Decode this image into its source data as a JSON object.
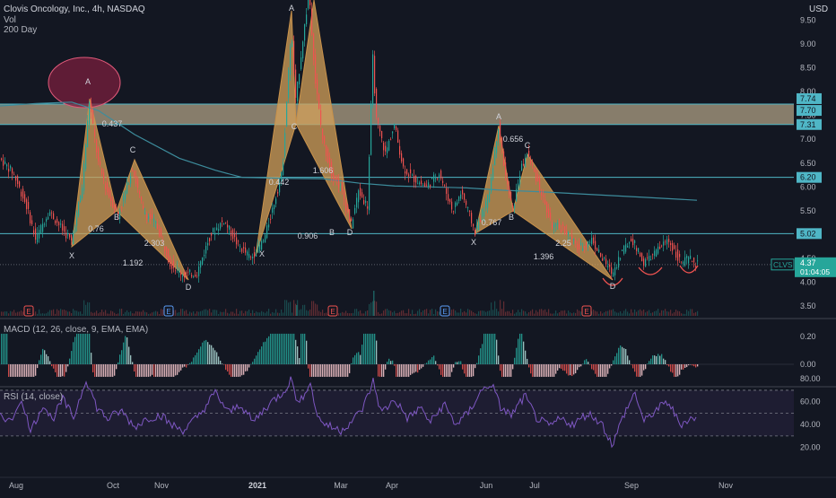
{
  "header": {
    "symbol_line": "Clovis Oncology, Inc., 4h, NASDAQ",
    "vol_label": "Vol",
    "ma_label": "200 Day",
    "currency": "USD"
  },
  "panes": {
    "macd_label": "MACD (12, 26, close, 9, EMA, EMA)",
    "rsi_label": "RSI (14, close)"
  },
  "colors": {
    "background": "#131722",
    "up_candle": "#26a69a",
    "down_candle": "#ef5350",
    "pattern_fill": "#d4a15a",
    "level_line": "#4fb6c6",
    "zone_fill": "#e8d2a8",
    "ma_line": "#3d8c9c",
    "rsi_line": "#7e57c2",
    "circle_fill": "#7a1f3d"
  },
  "chart_data": [
    {
      "type": "candlestick",
      "title": "Clovis Oncology, Inc., 4h, NASDAQ",
      "x_ticks": [
        "Aug",
        "Oct",
        "Nov",
        "2021",
        "Mar",
        "Apr",
        "Jun",
        "Jul",
        "Sep",
        "Nov"
      ],
      "y_ticks": [
        3.5,
        4.0,
        4.5,
        5.0,
        5.5,
        6.0,
        6.5,
        7.0,
        7.5,
        8.0,
        8.5,
        9.0,
        9.5
      ],
      "y_range": [
        3.3,
        10.0
      ],
      "last_price": 4.37,
      "countdown": "01:04:05",
      "ticker_tag": "CLVS",
      "price_labels": [
        7.74,
        7.7,
        7.31,
        6.2,
        5.02
      ],
      "horizontal_levels": [
        7.74,
        7.31,
        6.2,
        5.02
      ],
      "resistance_zone": [
        7.31,
        7.74
      ],
      "moving_average": {
        "name": "200 Day",
        "points": [
          [
            0,
            7.7
          ],
          [
            40,
            7.75
          ],
          [
            80,
            7.78
          ],
          [
            110,
            7.6
          ],
          [
            150,
            7.1
          ],
          [
            200,
            6.6
          ],
          [
            240,
            6.35
          ],
          [
            270,
            6.2
          ],
          [
            320,
            6.18
          ],
          [
            360,
            6.17
          ],
          [
            400,
            6.08
          ],
          [
            440,
            6.02
          ],
          [
            480,
            6.0
          ],
          [
            520,
            5.98
          ],
          [
            560,
            5.93
          ],
          [
            600,
            5.9
          ],
          [
            640,
            5.86
          ],
          [
            680,
            5.82
          ],
          [
            720,
            5.78
          ],
          [
            777,
            5.72
          ]
        ]
      },
      "price_path": [
        [
          0,
          6.6
        ],
        [
          15,
          6.3
        ],
        [
          30,
          5.6
        ],
        [
          40,
          4.9
        ],
        [
          55,
          5.5
        ],
        [
          70,
          5.1
        ],
        [
          80,
          4.85
        ],
        [
          92,
          6.0
        ],
        [
          100,
          7.8
        ],
        [
          110,
          6.5
        ],
        [
          120,
          5.9
        ],
        [
          132,
          5.4
        ],
        [
          140,
          5.9
        ],
        [
          148,
          6.4
        ],
        [
          160,
          5.5
        ],
        [
          175,
          5.2
        ],
        [
          190,
          4.4
        ],
        [
          205,
          4.15
        ],
        [
          220,
          4.2
        ],
        [
          235,
          5.0
        ],
        [
          250,
          5.3
        ],
        [
          265,
          4.8
        ],
        [
          280,
          4.5
        ],
        [
          295,
          4.9
        ],
        [
          305,
          5.6
        ],
        [
          315,
          6.3
        ],
        [
          325,
          9.3
        ],
        [
          330,
          7.8
        ],
        [
          338,
          9.1
        ],
        [
          345,
          10.1
        ],
        [
          352,
          8.2
        ],
        [
          360,
          7.0
        ],
        [
          370,
          6.3
        ],
        [
          380,
          6.0
        ],
        [
          392,
          5.2
        ],
        [
          400,
          5.9
        ],
        [
          410,
          5.6
        ],
        [
          416,
          8.7
        ],
        [
          420,
          7.4
        ],
        [
          430,
          6.7
        ],
        [
          440,
          7.3
        ],
        [
          450,
          6.4
        ],
        [
          460,
          6.2
        ],
        [
          475,
          6.0
        ],
        [
          490,
          6.3
        ],
        [
          505,
          5.5
        ],
        [
          515,
          5.9
        ],
        [
          530,
          5.05
        ],
        [
          545,
          5.8
        ],
        [
          556,
          7.3
        ],
        [
          565,
          6.1
        ],
        [
          572,
          5.5
        ],
        [
          580,
          6.3
        ],
        [
          588,
          6.7
        ],
        [
          600,
          6.1
        ],
        [
          615,
          5.2
        ],
        [
          630,
          5.1
        ],
        [
          645,
          4.7
        ],
        [
          660,
          4.9
        ],
        [
          670,
          4.55
        ],
        [
          683,
          4.18
        ],
        [
          695,
          4.7
        ],
        [
          705,
          4.9
        ],
        [
          718,
          4.4
        ],
        [
          730,
          4.6
        ],
        [
          745,
          4.9
        ],
        [
          760,
          4.4
        ],
        [
          768,
          4.5
        ],
        [
          777,
          4.37
        ]
      ],
      "patterns": [
        {
          "points": [
            "X",
            "A",
            "B",
            "C",
            "D"
          ],
          "ratios": [
            "0.437",
            "0.76",
            "2.303",
            "1.192"
          ]
        },
        {
          "points": [
            "X",
            "A",
            "B",
            "C",
            "D"
          ],
          "ratios": [
            "0.442",
            "1.606",
            "0.906"
          ]
        },
        {
          "points": [
            "X",
            "A",
            "B",
            "C",
            "D"
          ],
          "ratios": [
            "0.656",
            "0.767",
            "2.25",
            "1.396"
          ]
        }
      ],
      "earnings_markers": [
        "E",
        "E",
        "E",
        "E",
        "E"
      ]
    },
    {
      "type": "line",
      "title": "MACD (12, 26, close, 9, EMA, EMA)",
      "y_ticks": [
        0.2,
        0.0
      ],
      "y_range": [
        -0.1,
        0.3
      ]
    },
    {
      "type": "line",
      "title": "RSI (14, close)",
      "y_ticks": [
        80.0,
        60.0,
        40.0,
        20.0
      ],
      "y_range": [
        15,
        90
      ],
      "bands": [
        70,
        50,
        30
      ],
      "points": [
        [
          0,
          50
        ],
        [
          12,
          42
        ],
        [
          22,
          62
        ],
        [
          35,
          35
        ],
        [
          48,
          58
        ],
        [
          58,
          44
        ],
        [
          70,
          62
        ],
        [
          82,
          46
        ],
        [
          96,
          80
        ],
        [
          108,
          55
        ],
        [
          120,
          45
        ],
        [
          135,
          52
        ],
        [
          150,
          38
        ],
        [
          165,
          46
        ],
        [
          180,
          48
        ],
        [
          190,
          40
        ],
        [
          205,
          35
        ],
        [
          222,
          48
        ],
        [
          240,
          68
        ],
        [
          255,
          50
        ],
        [
          268,
          58
        ],
        [
          282,
          42
        ],
        [
          300,
          58
        ],
        [
          315,
          68
        ],
        [
          325,
          80
        ],
        [
          333,
          56
        ],
        [
          345,
          78
        ],
        [
          355,
          45
        ],
        [
          368,
          38
        ],
        [
          380,
          35
        ],
        [
          395,
          45
        ],
        [
          405,
          55
        ],
        [
          416,
          78
        ],
        [
          425,
          50
        ],
        [
          440,
          62
        ],
        [
          455,
          45
        ],
        [
          468,
          55
        ],
        [
          480,
          42
        ],
        [
          495,
          58
        ],
        [
          508,
          40
        ],
        [
          522,
          50
        ],
        [
          535,
          68
        ],
        [
          548,
          76
        ],
        [
          558,
          55
        ],
        [
          570,
          48
        ],
        [
          585,
          65
        ],
        [
          598,
          46
        ],
        [
          612,
          38
        ],
        [
          625,
          45
        ],
        [
          640,
          40
        ],
        [
          655,
          50
        ],
        [
          670,
          42
        ],
        [
          683,
          22
        ],
        [
          695,
          48
        ],
        [
          708,
          68
        ],
        [
          718,
          42
        ],
        [
          730,
          52
        ],
        [
          745,
          60
        ],
        [
          758,
          40
        ],
        [
          768,
          45
        ],
        [
          777,
          46
        ]
      ]
    }
  ]
}
